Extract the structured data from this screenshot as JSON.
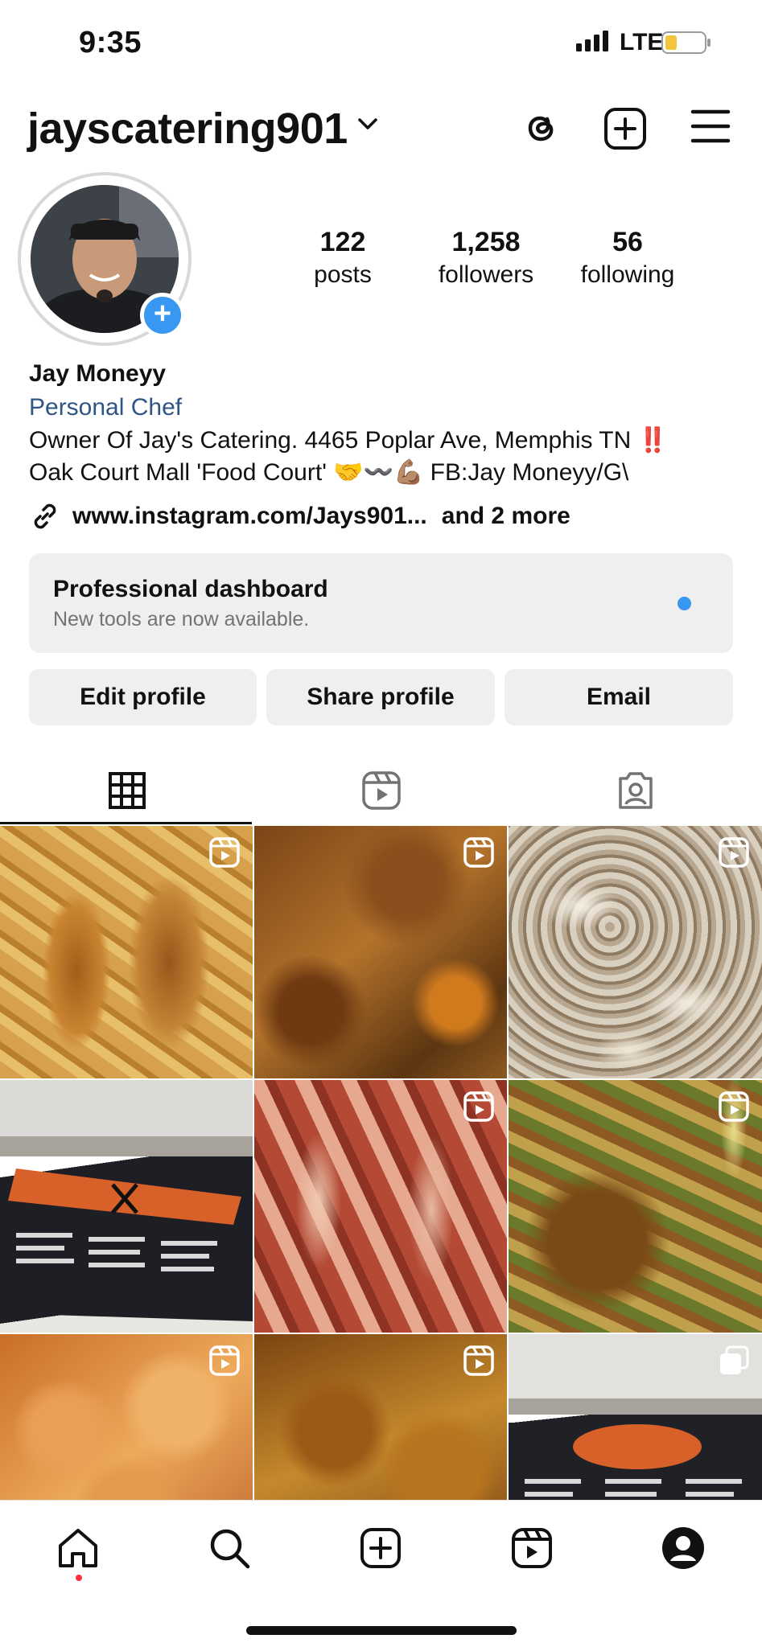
{
  "status_bar": {
    "time": "9:35",
    "network": "LTE"
  },
  "header": {
    "username": "jayscatering901"
  },
  "stats": [
    {
      "value": "122",
      "label": "posts"
    },
    {
      "value": "1,258",
      "label": "followers"
    },
    {
      "value": "56",
      "label": "following"
    }
  ],
  "bio": {
    "name": "Jay Moneyy",
    "category": "Personal Chef",
    "line1": "Owner Of Jay's Catering. 4465 Poplar Ave, Memphis TN ‼️",
    "line2": "Oak Court Mall 'Food Court' 🤝〰️💪🏽 FB:Jay Moneyy/G\\",
    "link": "www.instagram.com/Jays901...",
    "link_more": "and 2 more"
  },
  "dashboard": {
    "title": "Professional dashboard",
    "subtitle": "New tools are now available."
  },
  "actions": {
    "edit": "Edit profile",
    "share": "Share profile",
    "email": "Email"
  },
  "tabs": [
    "grid-icon",
    "reels-icon",
    "tagged-icon"
  ],
  "posts": [
    {
      "type": "reel",
      "subject": "fried fish and fries"
    },
    {
      "type": "reel",
      "subject": "seafood boil wings"
    },
    {
      "type": "reel",
      "subject": "loaded potatoes"
    },
    {
      "type": "image",
      "subject": "catering menu board"
    },
    {
      "type": "reel",
      "subject": "crab legs"
    },
    {
      "type": "reel",
      "subject": "wings with corn"
    },
    {
      "type": "reel",
      "subject": "shrimp"
    },
    {
      "type": "reel",
      "subject": "glazed wings"
    },
    {
      "type": "carousel",
      "subject": "catering menu board"
    }
  ],
  "colors": {
    "accent": "#3897f0",
    "link_blue": "#2d5586",
    "notification": "#ff3040"
  }
}
